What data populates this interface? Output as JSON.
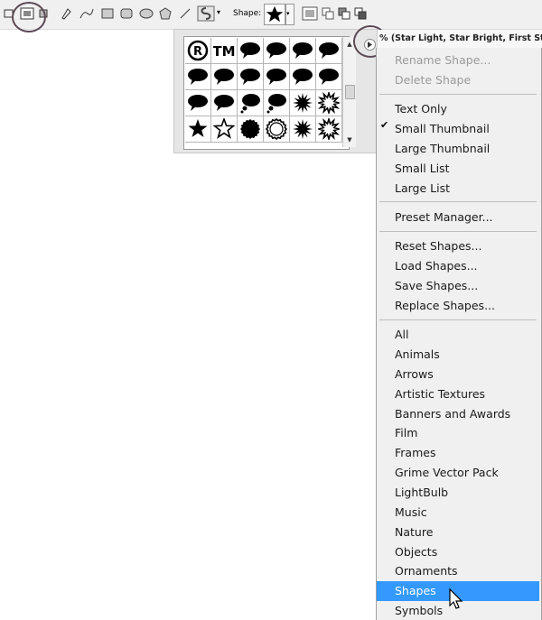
{
  "toolbar": {
    "shape_label": "Shape:"
  },
  "shape_grid": {
    "cells": [
      {
        "icon": "registered-icon"
      },
      {
        "icon": "trademark-icon"
      },
      {
        "icon": "speech-bubble-icon"
      },
      {
        "icon": "speech-bubble-icon"
      },
      {
        "icon": "speech-bubble-icon"
      },
      {
        "icon": "speech-bubble-icon"
      },
      {
        "icon": "speech-bubble-icon"
      },
      {
        "icon": "speech-bubble-icon"
      },
      {
        "icon": "speech-bubble-icon"
      },
      {
        "icon": "speech-bubble-icon"
      },
      {
        "icon": "speech-bubble-icon"
      },
      {
        "icon": "speech-bubble-icon"
      },
      {
        "icon": "speech-bubble-icon"
      },
      {
        "icon": "speech-bubble-icon"
      },
      {
        "icon": "thought-bubble-icon"
      },
      {
        "icon": "thought-bubble-icon"
      },
      {
        "icon": "starburst-icon"
      },
      {
        "icon": "starburst-outline-icon"
      },
      {
        "icon": "star-icon"
      },
      {
        "icon": "star-outline-icon"
      },
      {
        "icon": "seal-icon"
      },
      {
        "icon": "seal-outline-icon"
      },
      {
        "icon": "starburst-icon"
      },
      {
        "icon": "starburst-outline-icon"
      }
    ]
  },
  "status_text": "% (Star Light, Star Bright, First Sta",
  "menu": {
    "items": [
      {
        "label": "Rename Shape...",
        "disabled": true
      },
      {
        "label": "Delete Shape",
        "disabled": true
      },
      {
        "label": "Text Only"
      },
      {
        "label": "Small Thumbnail",
        "checked": true
      },
      {
        "label": "Large Thumbnail"
      },
      {
        "label": "Small List"
      },
      {
        "label": "Large List"
      },
      {
        "label": "Preset Manager..."
      },
      {
        "label": "Reset Shapes..."
      },
      {
        "label": "Load Shapes..."
      },
      {
        "label": "Save Shapes..."
      },
      {
        "label": "Replace Shapes..."
      },
      {
        "label": "All"
      },
      {
        "label": "Animals"
      },
      {
        "label": "Arrows"
      },
      {
        "label": "Artistic Textures"
      },
      {
        "label": "Banners and Awards"
      },
      {
        "label": "Film"
      },
      {
        "label": "Frames"
      },
      {
        "label": "Grime Vector Pack"
      },
      {
        "label": "LightBulb"
      },
      {
        "label": "Music"
      },
      {
        "label": "Nature"
      },
      {
        "label": "Objects"
      },
      {
        "label": "Ornaments"
      },
      {
        "label": "Shapes",
        "highlighted": true
      },
      {
        "label": "Symbols"
      }
    ]
  },
  "colors": {
    "highlight": "#3399ff",
    "menu_bg": "#f0f0f0",
    "disabled_text": "#9a9a9a",
    "annotation_circle": "#5a4a55"
  }
}
